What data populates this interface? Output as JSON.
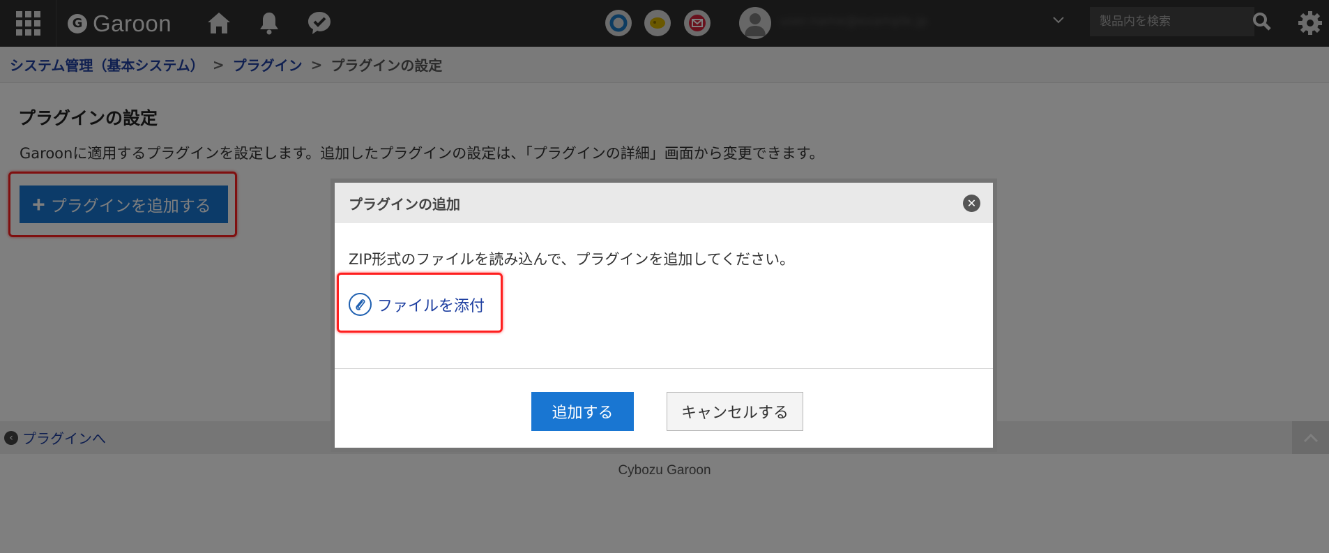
{
  "header": {
    "logo_text": "Garoon",
    "logo_mark": "G",
    "search_placeholder": "製品内を検索",
    "user_name": "user.name@example.jp",
    "icons": [
      "apps-grid-icon",
      "home-icon",
      "bell-icon",
      "chat-check-icon",
      "status-circle-icon",
      "presence-icon",
      "mail-icon",
      "user-avatar-icon",
      "chevron-down-icon",
      "search-icon",
      "gear-icon"
    ]
  },
  "breadcrumb": {
    "items": [
      "システム管理（基本システム）",
      "プラグイン"
    ],
    "separator": ">",
    "current": "プラグインの設定"
  },
  "main": {
    "title": "プラグインの設定",
    "description": "Garoonに適用するプラグインを設定します。追加したプラグインの設定は、「プラグインの詳細」画面から変更できます。",
    "add_button_label": "プラグインを追加する",
    "back_link": "プラグインへ"
  },
  "footer": {
    "text": "Cybozu Garoon"
  },
  "dialog": {
    "title": "プラグインの追加",
    "message": "ZIP形式のファイルを読み込んで、プラグインを追加してください。",
    "attach_label": "ファイルを添付",
    "confirm_label": "追加する",
    "cancel_label": "キャンセルする"
  },
  "colors": {
    "header_bg": "#2f2f2f",
    "primary": "#1976d2",
    "link": "#1e3fa0",
    "highlight": "#ff1f1f"
  }
}
